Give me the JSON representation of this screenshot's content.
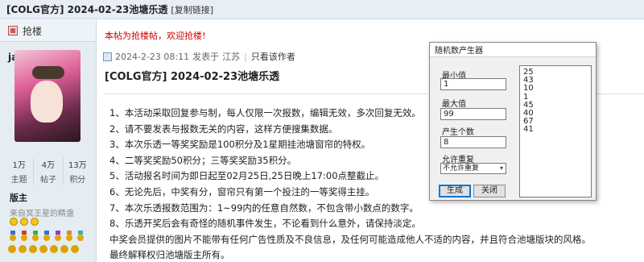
{
  "thread": {
    "title": "[COLG官方] 2024-02-23池塘乐透",
    "copy_link": "[复制链接]"
  },
  "sidebar": {
    "grab_label": "抢楼",
    "username": "janus",
    "stats": [
      {
        "value": "1万",
        "label": "主题"
      },
      {
        "value": "4万",
        "label": "帖子"
      },
      {
        "value": "13万",
        "label": "积分"
      }
    ],
    "rank": "版主",
    "user_title": "来自冥王星的精盏"
  },
  "post": {
    "notice": "本帖为抢楼帖，欢迎抢楼!",
    "timestamp": "2024-2-23 08:11",
    "posted_from_prefix": "发表于",
    "location": "江苏",
    "only_author": "只看该作者",
    "title": "[COLG官方] 2024-02-23池塘乐透",
    "lines": [
      "1、本活动采取回复参与制，每人仅限一次报数，编辑无效，多次回复无效。",
      "2、请不要发表与报数无关的内容，这样方便搜集数据。",
      "3、本次乐透一等奖奖励是100积分及1星期挂池塘窗帘的特权。",
      "4、二等奖奖励50积分；三等奖奖励35积分。",
      "5、活动报名时间为即日起至02月25日,25日晚上17:00点整截止。",
      "6、无论先后，中奖有分，窗帘只有第一个投注的一等奖得主挂。",
      "7、本次乐透报数范围为：1~99内的任意自然数，不包含带小数点的数字。",
      "8、乐透开奖后会有奇怪的随机事件发生，不论看到什么意外，请保持淡定。",
      "中奖会员提供的图片不能带有任何广告性质及不良信息，及任何可能造成他人不适的内容，并且符合池塘版块的风格。",
      "最终解释权归池塘版主所有。"
    ]
  },
  "generator": {
    "title": "随机数产生器",
    "min_label": "最小值",
    "min_value": "1",
    "max_label": "最大值",
    "max_value": "99",
    "count_label": "产生个数",
    "count_value": "8",
    "repeat_label": "允许重复",
    "repeat_value": "不允许重复",
    "generate_label": "生成",
    "close_label": "关闭",
    "results": [
      "25",
      "43",
      "10",
      "1",
      "45",
      "40",
      "67",
      "41"
    ]
  },
  "colors": {
    "notice": "#d10000",
    "sidebar_bg": "#e5edf2",
    "header_bg": "#e8eef6"
  }
}
